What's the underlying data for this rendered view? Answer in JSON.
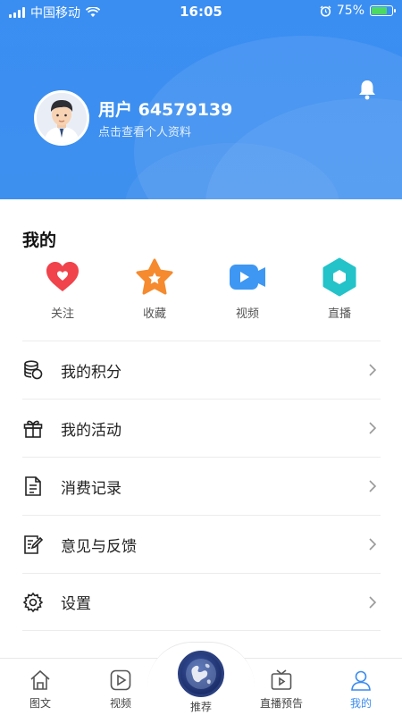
{
  "status_bar": {
    "carrier": "中国移动",
    "time": "16:05",
    "battery": "75%",
    "battery_level": 0.75
  },
  "profile": {
    "username": "用户 64579139",
    "subtitle": "点击查看个人资料"
  },
  "my_section": {
    "title": "我的",
    "quick_actions": [
      {
        "label": "关注",
        "icon": "heart-icon",
        "color": "#f0434b"
      },
      {
        "label": "收藏",
        "icon": "star-icon",
        "color": "#f58a2e"
      },
      {
        "label": "视频",
        "icon": "video-camera-icon",
        "color": "#3e97f3"
      },
      {
        "label": "直播",
        "icon": "hexagon-icon",
        "color": "#23c3c9"
      }
    ]
  },
  "menu": [
    {
      "label": "我的积分",
      "icon": "coins-icon"
    },
    {
      "label": "我的活动",
      "icon": "gift-icon"
    },
    {
      "label": "消费记录",
      "icon": "document-icon"
    },
    {
      "label": "意见与反馈",
      "icon": "feedback-icon"
    },
    {
      "label": "设置",
      "icon": "gear-icon"
    }
  ],
  "tab_bar": {
    "items": [
      {
        "label": "图文",
        "icon": "home-icon",
        "active": false
      },
      {
        "label": "视频",
        "icon": "play-icon",
        "active": false
      },
      {
        "label": "推荐",
        "icon": "globe-icon",
        "active": false
      },
      {
        "label": "直播预告",
        "icon": "tv-icon",
        "active": false
      },
      {
        "label": "我的",
        "icon": "user-icon",
        "active": true
      }
    ],
    "active_color": "#3b8cf0"
  },
  "colors": {
    "header_blue": "#3a8ef2",
    "accent": "#3b8cf0"
  }
}
